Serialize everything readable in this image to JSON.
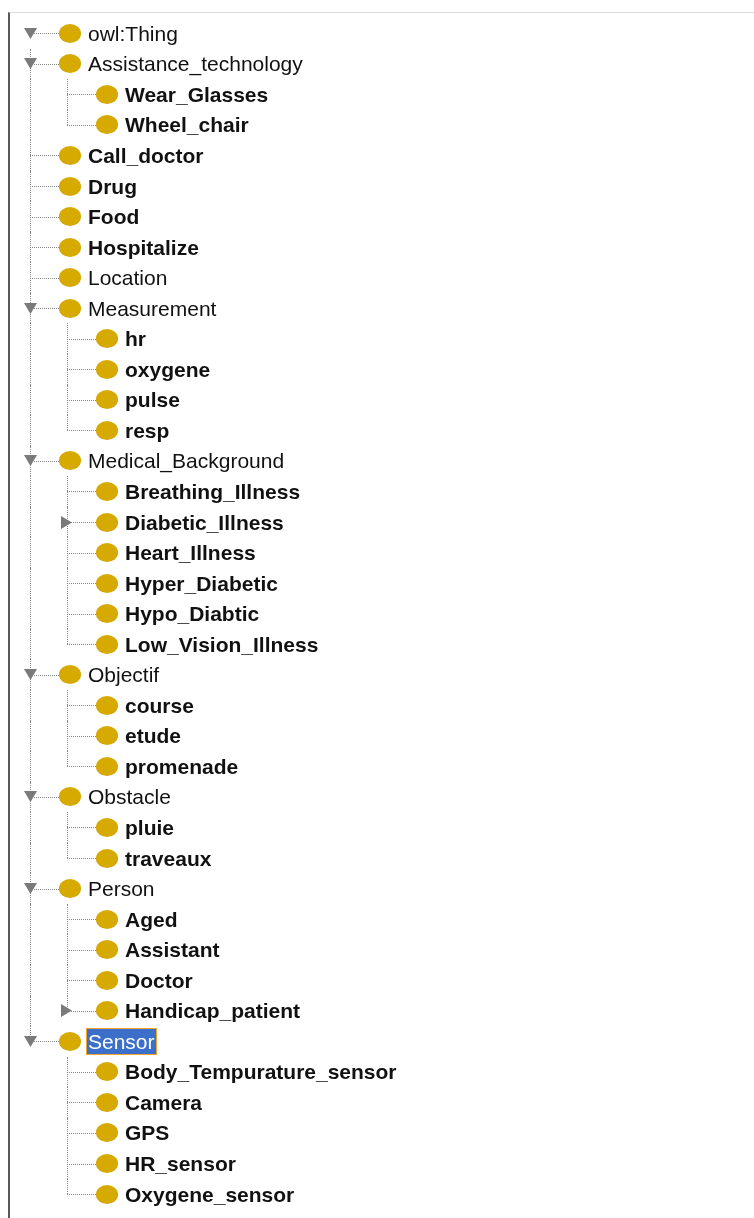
{
  "tree": [
    {
      "label": "owl:Thing",
      "bold": false,
      "selected": false,
      "expanded": true,
      "children": [
        {
          "label": "Assistance_technology",
          "bold": false,
          "selected": false,
          "expanded": true,
          "children": [
            {
              "label": "Wear_Glasses",
              "bold": true,
              "selected": false
            },
            {
              "label": "Wheel_chair",
              "bold": true,
              "selected": false
            }
          ]
        },
        {
          "label": "Call_doctor",
          "bold": true,
          "selected": false
        },
        {
          "label": "Drug",
          "bold": true,
          "selected": false
        },
        {
          "label": "Food",
          "bold": true,
          "selected": false
        },
        {
          "label": "Hospitalize",
          "bold": true,
          "selected": false
        },
        {
          "label": "Location",
          "bold": false,
          "selected": false
        },
        {
          "label": "Measurement",
          "bold": false,
          "selected": false,
          "expanded": true,
          "children": [
            {
              "label": "hr",
              "bold": true,
              "selected": false
            },
            {
              "label": "oxygene",
              "bold": true,
              "selected": false
            },
            {
              "label": "pulse",
              "bold": true,
              "selected": false
            },
            {
              "label": "resp",
              "bold": true,
              "selected": false
            }
          ]
        },
        {
          "label": "Medical_Background",
          "bold": false,
          "selected": false,
          "expanded": true,
          "children": [
            {
              "label": "Breathing_Illness",
              "bold": true,
              "selected": false
            },
            {
              "label": "Diabetic_Illness",
              "bold": true,
              "selected": false,
              "expanded": false
            },
            {
              "label": "Heart_Illness",
              "bold": true,
              "selected": false
            },
            {
              "label": "Hyper_Diabetic",
              "bold": true,
              "selected": false
            },
            {
              "label": "Hypo_Diabtic",
              "bold": true,
              "selected": false
            },
            {
              "label": "Low_Vision_Illness",
              "bold": true,
              "selected": false
            }
          ]
        },
        {
          "label": "Objectif",
          "bold": false,
          "selected": false,
          "expanded": true,
          "children": [
            {
              "label": "course",
              "bold": true,
              "selected": false
            },
            {
              "label": "etude",
              "bold": true,
              "selected": false
            },
            {
              "label": "promenade",
              "bold": true,
              "selected": false
            }
          ]
        },
        {
          "label": "Obstacle",
          "bold": false,
          "selected": false,
          "expanded": true,
          "children": [
            {
              "label": "pluie",
              "bold": true,
              "selected": false
            },
            {
              "label": "traveaux",
              "bold": true,
              "selected": false
            }
          ]
        },
        {
          "label": "Person",
          "bold": false,
          "selected": false,
          "expanded": true,
          "children": [
            {
              "label": "Aged",
              "bold": true,
              "selected": false
            },
            {
              "label": "Assistant",
              "bold": true,
              "selected": false
            },
            {
              "label": "Doctor",
              "bold": true,
              "selected": false
            },
            {
              "label": "Handicap_patient",
              "bold": true,
              "selected": false,
              "expanded": false
            }
          ]
        },
        {
          "label": "Sensor",
          "bold": false,
          "selected": true,
          "expanded": true,
          "children": [
            {
              "label": "Body_Tempurature_sensor",
              "bold": true,
              "selected": false
            },
            {
              "label": "Camera",
              "bold": true,
              "selected": false
            },
            {
              "label": "GPS",
              "bold": true,
              "selected": false
            },
            {
              "label": "HR_sensor",
              "bold": true,
              "selected": false
            },
            {
              "label": "Oxygene_sensor",
              "bold": true,
              "selected": false
            }
          ]
        }
      ]
    }
  ]
}
